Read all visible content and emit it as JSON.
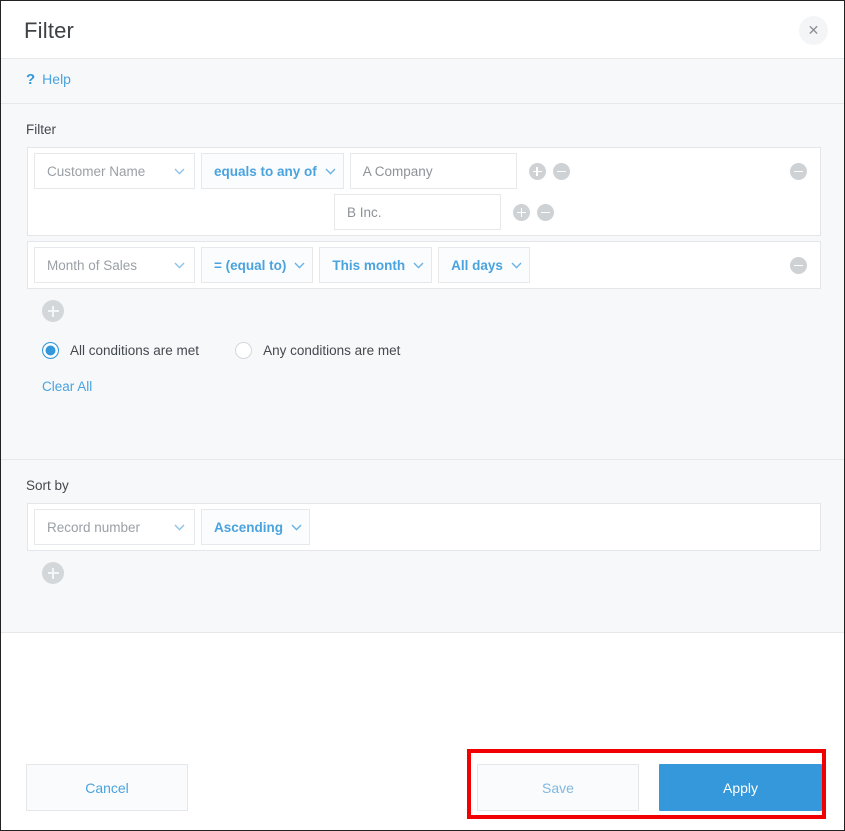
{
  "window": {
    "title": "Filter",
    "close_icon": "close-icon"
  },
  "helpbar": {
    "icon": "question-mark-icon",
    "label": "Help"
  },
  "filter": {
    "section_label": "Filter",
    "conditions": [
      {
        "field": "Customer Name",
        "operator": "equals to any of",
        "values": [
          "A Company",
          "B Inc."
        ]
      },
      {
        "field": "Month of Sales",
        "operator": "= (equal to)",
        "period": "This month",
        "days": "All days"
      }
    ],
    "add_condition_icon": "plus-circle-icon",
    "match_modes": [
      {
        "label": "All conditions are met",
        "selected": true
      },
      {
        "label": "Any conditions are met",
        "selected": false
      }
    ],
    "clear_all_label": "Clear All"
  },
  "sort": {
    "section_label": "Sort by",
    "rows": [
      {
        "field": "Record number",
        "direction": "Ascending"
      }
    ],
    "add_sort_icon": "plus-circle-icon"
  },
  "footer": {
    "cancel_label": "Cancel",
    "save_label": "Save",
    "apply_label": "Apply"
  },
  "colors": {
    "accent": "#3498db",
    "link": "#4aa3df",
    "highlight": "#f20000",
    "panel_bg": "#f7f8fa",
    "border": "#e6e8ea"
  }
}
